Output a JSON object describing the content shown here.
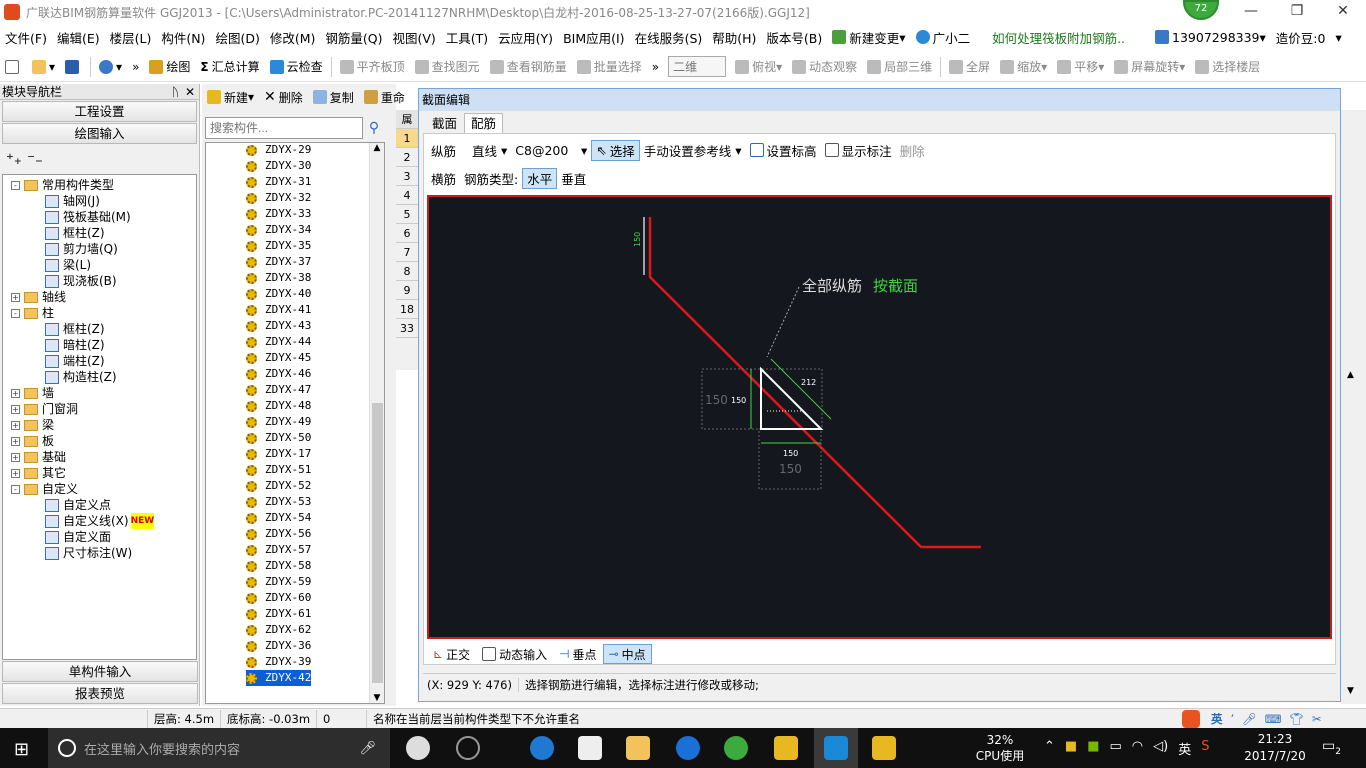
{
  "titlebar": {
    "title": "广联达BIM钢筋算量软件 GGJ2013 - [C:\\Users\\Administrator.PC-20141127NRHM\\Desktop\\白龙村-2016-08-25-13-27-07(2166版).GGJ12]",
    "badge": "72"
  },
  "menubar": {
    "items": [
      "文件(F)",
      "编辑(E)",
      "楼层(L)",
      "构件(N)",
      "绘图(D)",
      "修改(M)",
      "钢筋量(Q)",
      "视图(V)",
      "工具(T)",
      "云应用(Y)",
      "BIM应用(I)",
      "在线服务(S)",
      "帮助(H)",
      "版本号(B)",
      "新建变更",
      "广小二"
    ],
    "promo": "如何处理筏板附加钢筋..",
    "phone": "13907298339",
    "coins": "造价豆:0"
  },
  "toolbar": {
    "draw": "绘图",
    "sum": "汇总计算",
    "cloudcheck": "云检查",
    "align": "平齐板顶",
    "find": "查找图元",
    "viewsteel": "查看钢筋量",
    "batch": "批量选择",
    "view2d": "二维",
    "top": "俯视",
    "dynamic": "动态观察",
    "local3d": "局部三维",
    "fullscreen": "全屏",
    "zoom": "缩放",
    "pan": "平移",
    "rotate": "屏幕旋转",
    "selfloor": "选择楼层"
  },
  "nav": {
    "title": "模块导航栏",
    "btn_project": "工程设置",
    "btn_draw": "绘图输入",
    "btn_single": "单构件输入",
    "btn_report": "报表预览",
    "tree": [
      {
        "label": "常用构件类型",
        "level": 0,
        "exp": "-",
        "icon": "folder"
      },
      {
        "label": "轴网(J)",
        "level": 1,
        "icon": "leaf"
      },
      {
        "label": "筏板基础(M)",
        "level": 1,
        "icon": "leaf"
      },
      {
        "label": "框柱(Z)",
        "level": 1,
        "icon": "leaf"
      },
      {
        "label": "剪力墙(Q)",
        "level": 1,
        "icon": "leaf"
      },
      {
        "label": "梁(L)",
        "level": 1,
        "icon": "leaf"
      },
      {
        "label": "现浇板(B)",
        "level": 1,
        "icon": "leaf"
      },
      {
        "label": "轴线",
        "level": 0,
        "exp": "+",
        "icon": "folder"
      },
      {
        "label": "柱",
        "level": 0,
        "exp": "-",
        "icon": "folder"
      },
      {
        "label": "框柱(Z)",
        "level": 1,
        "icon": "leaf"
      },
      {
        "label": "暗柱(Z)",
        "level": 1,
        "icon": "leaf"
      },
      {
        "label": "端柱(Z)",
        "level": 1,
        "icon": "leaf"
      },
      {
        "label": "构造柱(Z)",
        "level": 1,
        "icon": "leaf"
      },
      {
        "label": "墙",
        "level": 0,
        "exp": "+",
        "icon": "folder"
      },
      {
        "label": "门窗洞",
        "level": 0,
        "exp": "+",
        "icon": "folder"
      },
      {
        "label": "梁",
        "level": 0,
        "exp": "+",
        "icon": "folder"
      },
      {
        "label": "板",
        "level": 0,
        "exp": "+",
        "icon": "folder"
      },
      {
        "label": "基础",
        "level": 0,
        "exp": "+",
        "icon": "folder"
      },
      {
        "label": "其它",
        "level": 0,
        "exp": "+",
        "icon": "folder"
      },
      {
        "label": "自定义",
        "level": 0,
        "exp": "-",
        "icon": "folder"
      },
      {
        "label": "自定义点",
        "level": 1,
        "icon": "leaf"
      },
      {
        "label": "自定义线(X)",
        "level": 1,
        "icon": "leaf",
        "tag": "NEW"
      },
      {
        "label": "自定义面",
        "level": 1,
        "icon": "leaf"
      },
      {
        "label": "尺寸标注(W)",
        "level": 1,
        "icon": "leaf"
      }
    ]
  },
  "list": {
    "new": "新建",
    "delete": "删除",
    "copy": "复制",
    "rename": "重命",
    "search_placeholder": "搜索构件...",
    "items": [
      "ZDYX-29",
      "ZDYX-30",
      "ZDYX-31",
      "ZDYX-32",
      "ZDYX-33",
      "ZDYX-34",
      "ZDYX-35",
      "ZDYX-37",
      "ZDYX-38",
      "ZDYX-40",
      "ZDYX-41",
      "ZDYX-43",
      "ZDYX-44",
      "ZDYX-45",
      "ZDYX-46",
      "ZDYX-47",
      "ZDYX-48",
      "ZDYX-49",
      "ZDYX-50",
      "ZDYX-17",
      "ZDYX-51",
      "ZDYX-52",
      "ZDYX-53",
      "ZDYX-54",
      "ZDYX-56",
      "ZDYX-57",
      "ZDYX-58",
      "ZDYX-59",
      "ZDYX-60",
      "ZDYX-61",
      "ZDYX-62",
      "ZDYX-36",
      "ZDYX-39",
      "ZDYX-42"
    ],
    "selected": "ZDYX-42"
  },
  "bgtable": {
    "header": "属",
    "rows": [
      "1",
      "2",
      "3",
      "4",
      "5",
      "6",
      "7",
      "8",
      "9",
      "18",
      "33"
    ]
  },
  "dialog": {
    "title": "截面编辑",
    "tab1": "截面",
    "tab2": "配筋",
    "row1": {
      "long": "纵筋",
      "line": "直线",
      "spec": "C8@200",
      "select": "选择",
      "ref": "手动设置参考线",
      "elev": "设置标高",
      "showdim": "显示标注",
      "del": "删除"
    },
    "row2": {
      "trans": "横筋",
      "type_label": "钢筋类型:",
      "horiz": "水平",
      "vert": "垂直"
    },
    "canvas": {
      "dim_top": "150",
      "label_all": "全部纵筋",
      "label_by": "按截面",
      "dim_212": "212",
      "dim_150a": "150",
      "dim_150b": "150",
      "dim_150c": "150",
      "dim_150d": "150"
    },
    "bottom": {
      "ortho": "正交",
      "dynin": "动态输入",
      "perp": "垂点",
      "mid": "中点"
    },
    "status_coord": "(X: 929 Y: 476)",
    "status_msg": "选择钢筋进行编辑，选择标注进行修改或移动;"
  },
  "statusbar": {
    "height": "层高: 4.5m",
    "bottom": "底标高: -0.03m",
    "zero": "0",
    "msg": "名称在当前层当前构件类型下不允许重名"
  },
  "taskbar": {
    "search": "在这里输入你要搜索的内容",
    "cpu_pct": "32%",
    "cpu_label": "CPU使用",
    "time": "21:23",
    "date": "2017/7/20",
    "ime": "英",
    "notif": "2"
  }
}
